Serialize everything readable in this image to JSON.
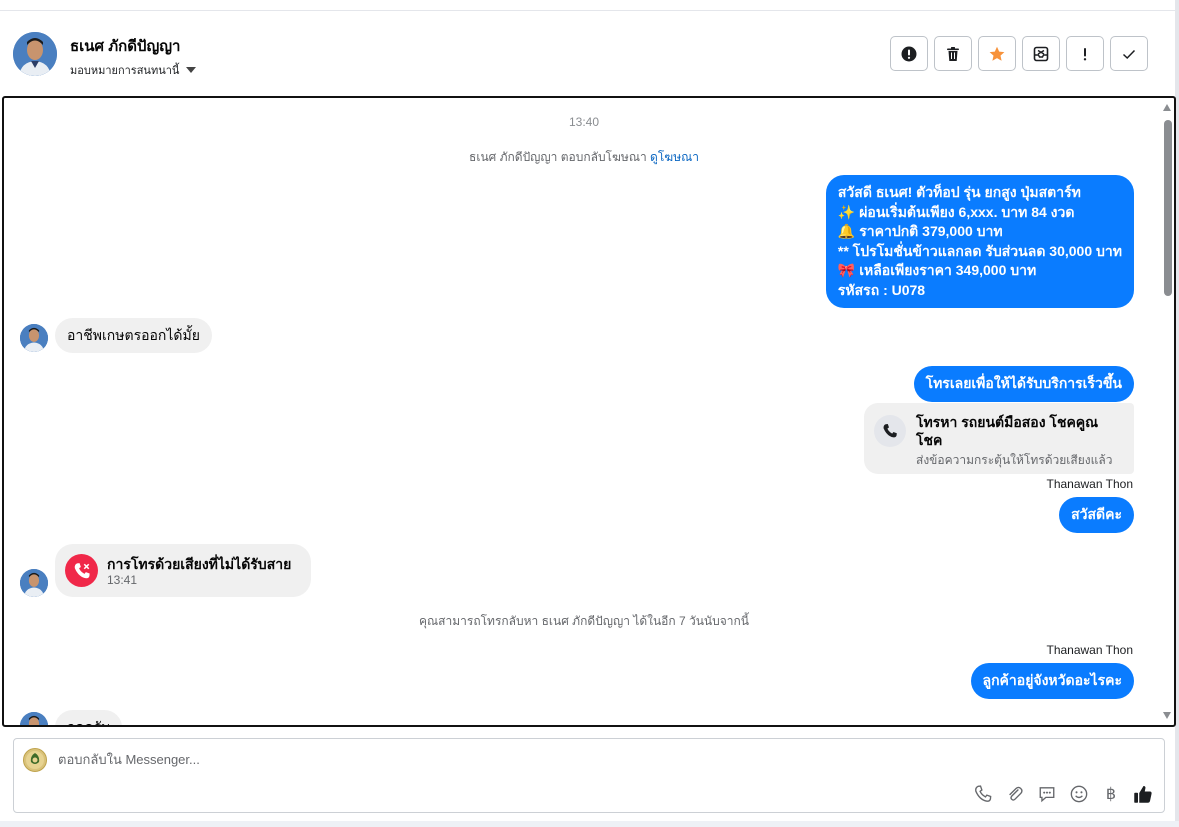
{
  "header": {
    "contact_name": "ธเนศ ภักดีปัญญา",
    "assign_label": "มอบหมายการสนทนานี้",
    "actions": [
      {
        "icon": "alert-circle-icon"
      },
      {
        "icon": "trash-icon"
      },
      {
        "icon": "star-icon"
      },
      {
        "icon": "archive-icon"
      },
      {
        "icon": "exclamation-icon"
      },
      {
        "icon": "check-icon"
      }
    ]
  },
  "conversation": {
    "timestamp_1": "13:40",
    "system_reply_text": "ธเนศ ภักดีปัญญา ตอบกลับโฆษณา",
    "system_reply_link": "ดูโฆษณา",
    "ad_message_lines": [
      "สวัสดี ธเนศ! ตัวท็อป รุ่น ยกสูง ปุ่มสตาร์ท",
      "✨  ผ่อนเริ่มต้นเพียง 6,xxx. บาท 84 งวด",
      "🔔 ราคาปกติ 379,000 บาท",
      "** โปรโมชั่นข้าวแลกลด รับส่วนลด 30,000 บาท",
      "🎀  เหลือเพียงราคา 349,000 บาท",
      " รหัสรถ : U078"
    ],
    "incoming_1": "อาชีพเกษตรออกได้มั้ย",
    "outgoing_call_prompt": "โทรเลยเพื่อให้ได้รับบริการเร็วขึ้น",
    "call_card_title": "โทรหา รถยนต์มือสอง โชคคูณ โชค",
    "call_card_sub": "ส่งข้อความกระตุ้นให้โทรด้วยเสียงแล้ว",
    "sender_1": "Thanawan Thon",
    "outgoing_hello": "สวัสดีคะ",
    "missed_call_title": "การโทรด้วยเสียงที่ไม่ได้รับสาย",
    "missed_call_time": "13:41",
    "callback_notice": "คุณสามารถโทรกลับหา ธเนศ ภักดีปัญญา ได้ในอีก 7 วันนับจากนี้",
    "sender_2": "Thanawan Thon",
    "outgoing_province": "ลูกค้าอยู่จังหวัดอะไรคะ",
    "incoming_2_partial": "จดครับ"
  },
  "composer": {
    "placeholder": "ตอบกลับใน Messenger...",
    "tools": [
      "phone-icon",
      "attachment-icon",
      "saved-replies-icon",
      "emoji-icon",
      "baht-icon",
      "like-icon"
    ],
    "baht_symbol": "฿"
  },
  "colors": {
    "outgoing_bubble": "#0a7cff",
    "incoming_bubble": "#f0f0f0",
    "missed_call": "#f02849",
    "star": "#f7923a",
    "link": "#0a66c2"
  }
}
